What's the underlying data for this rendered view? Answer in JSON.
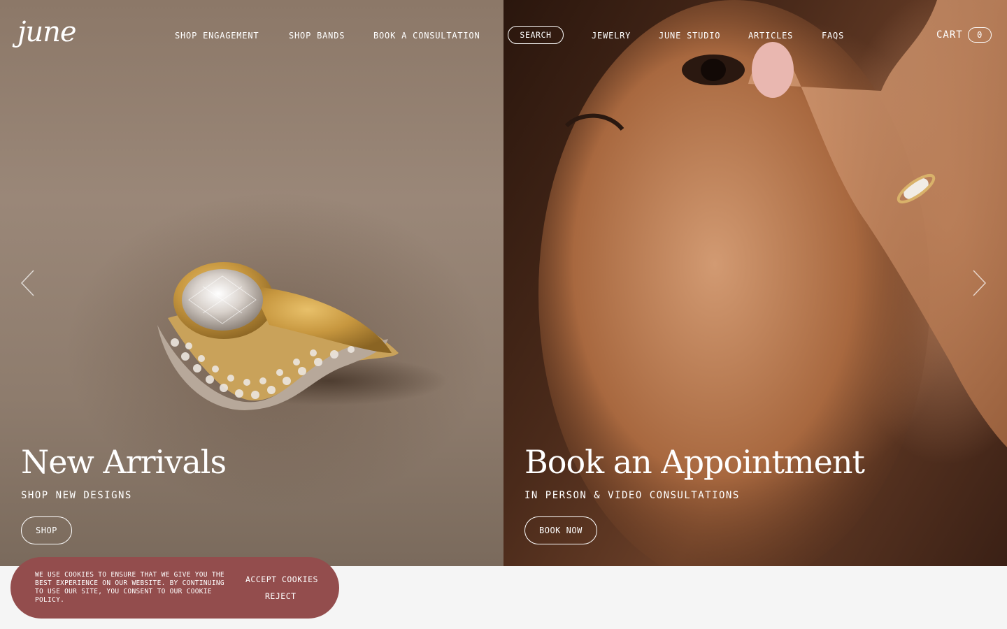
{
  "brand": {
    "logo_text": "june"
  },
  "nav": {
    "shop_engagement": "SHOP ENGAGEMENT",
    "shop_bands": "SHOP BANDS",
    "book_consultation": "BOOK A CONSULTATION",
    "search": "SEARCH",
    "jewelry": "JEWELRY",
    "june_studio": "JUNE STUDIO",
    "articles": "ARTICLES",
    "faqs": "FAQS"
  },
  "cart": {
    "label": "CART",
    "count": "0"
  },
  "hero": {
    "left": {
      "title": "New Arrivals",
      "subtitle": "SHOP NEW DESIGNS",
      "button": "SHOP"
    },
    "right": {
      "title": "Book an Appointment",
      "subtitle": "IN PERSON & VIDEO CONSULTATIONS",
      "button": "BOOK NOW"
    }
  },
  "carousel": {
    "prev_icon": "chevron-left-icon",
    "next_icon": "chevron-right-icon"
  },
  "cookie_banner": {
    "text": "WE USE COOKIES TO ENSURE THAT WE GIVE YOU THE BEST EXPERIENCE ON OUR WEBSITE. BY CONTINUING TO USE OUR SITE, YOU CONSENT TO OUR COOKIE POLICY.",
    "accept": "ACCEPT COOKIES",
    "reject": "REJECT",
    "color": "#934d4d"
  }
}
